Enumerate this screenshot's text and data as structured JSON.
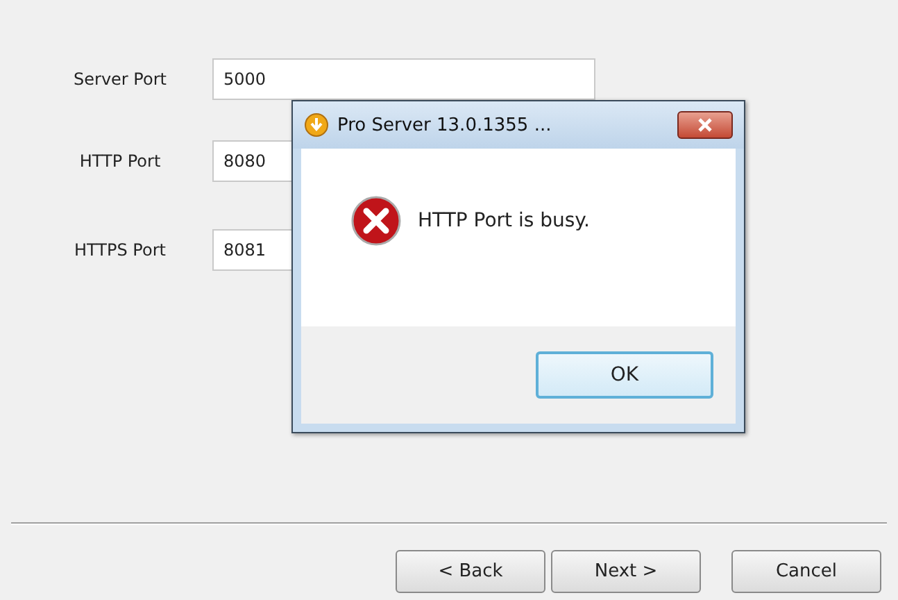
{
  "fields": [
    {
      "label": "Server Port",
      "value": "5000"
    },
    {
      "label": "HTTP Port",
      "value": "8080"
    },
    {
      "label": "HTTPS Port",
      "value": "8081"
    }
  ],
  "buttons": [
    {
      "label": "< Back"
    },
    {
      "label": "Next >"
    },
    {
      "label": "Cancel"
    }
  ],
  "dialog": {
    "title": "Pro Server 13.0.1355 ...",
    "message": "HTTP Port is busy.",
    "button": "OK"
  }
}
